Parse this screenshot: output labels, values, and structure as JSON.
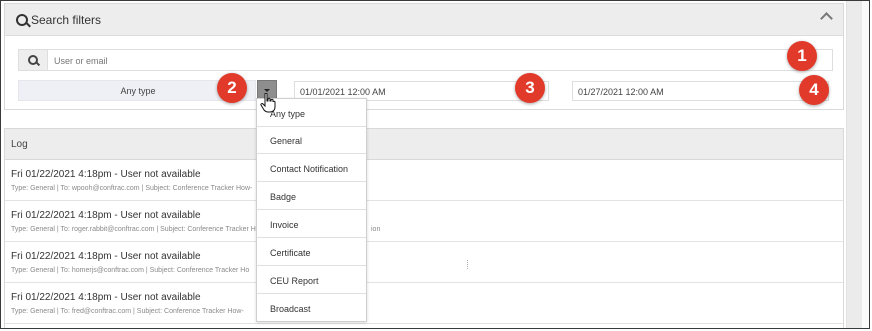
{
  "filters": {
    "title": "Search filters",
    "user_placeholder": "User or email",
    "type_selected": "Any type",
    "date_from": "01/01/2021 12:00 AM",
    "date_to": "01/27/2021 12:00 AM"
  },
  "dropdown": {
    "options": [
      "Any type",
      "General",
      "Contact Notification",
      "Badge",
      "Invoice",
      "Certificate",
      "CEU Report",
      "Broadcast"
    ]
  },
  "log": {
    "title": "Log",
    "rows": [
      {
        "main": "Fri 01/22/2021 4:18pm - User not available",
        "sub": "Type: General | To: wpooh@conftrac.com | Subject: Conference Tracker How-"
      },
      {
        "main": "Fri 01/22/2021 4:18pm - User not available",
        "sub": "Type: General | To: roger.rabbit@conftrac.com | Subject: Conference Tracker Ho",
        "sub_tail": "ion"
      },
      {
        "main": "Fri 01/22/2021 4:18pm - User not available",
        "sub": "Type: General | To: homerjs@conftrac.com | Subject: Conference Tracker Ho"
      },
      {
        "main": "Fri 01/22/2021 4:18pm - User not available",
        "sub": "Type: General | To: fred@conftrac.com | Subject: Conference Tracker How-"
      }
    ]
  },
  "callouts": [
    "1",
    "2",
    "3",
    "4"
  ],
  "icons": {
    "filter_search": "search-icon",
    "collapse": "chevron-up-icon",
    "user_search": "search-icon",
    "dropdown_toggle": "caret-down-icon",
    "pointer": "hand-cursor-icon"
  },
  "colors": {
    "callout": "#e23a2a",
    "header_bg": "#ededed",
    "select_bg": "#eef0f5",
    "dropdown_button": "#8e8e8e"
  }
}
